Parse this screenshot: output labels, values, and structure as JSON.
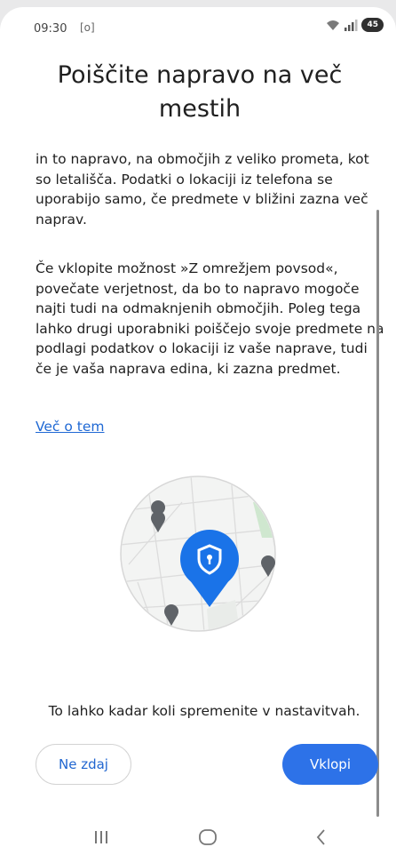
{
  "status": {
    "time": "09:30",
    "cam_glyph": "[o]",
    "battery": "45"
  },
  "dialog": {
    "title": "Poiščite napravo na več mestih",
    "paragraph1": "in to napravo, na območjih z veliko prometa, kot so letališča. Podatki o lokaciji iz telefona se uporabijo samo, če predmete v bližini zazna več naprav.",
    "paragraph2": "Če vklopite možnost »Z omrežjem povsod«, povečate verjetnost, da bo to napravo mogoče najti tudi na odmaknjenih območjih. Poleg tega lahko drugi uporabniki poiščejo svoje predmete na podlagi podatkov o lokaciji iz vaše naprave, tudi če je vaša naprava edina, ki zazna predmet.",
    "more_link": "Več o tem",
    "note": "To lahko kadar koli spremenite v nastavitvah.",
    "later_button": "Ne zdaj",
    "enable_button": "Vklopi"
  },
  "illustration": {
    "icon": "shield-pin-icon",
    "accent": "#1a73e8"
  },
  "colors": {
    "accent": "#2d72e8",
    "link": "#2069d4"
  }
}
